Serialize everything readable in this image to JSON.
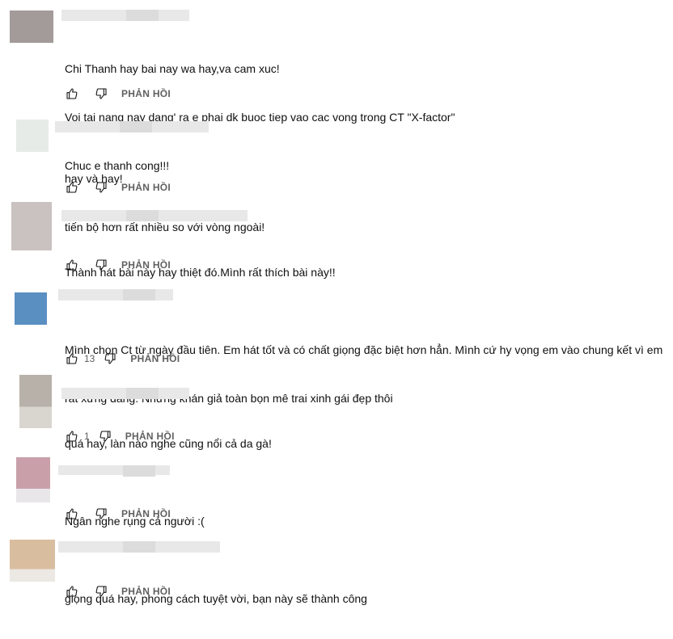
{
  "comments": [
    {
      "lines": [
        "Chi Thanh hay bai nay wa hay,va cam xuc!",
        "Voi tai nang nay dang' ra e phai dk buoc tiep vao cac vong trong CT \"X-factor\"",
        "Chuc e thanh cong!!!"
      ],
      "likes": "",
      "reply_label": "PHẢN HỒI",
      "avatar_color": "#a39a9a"
    },
    {
      "lines": [
        "hay và hay!",
        "tiến bộ hơn rất nhiều so với vòng ngoài!"
      ],
      "likes": "",
      "reply_label": "PHẢN HỒI",
      "avatar_color": "#e6ebe7"
    },
    {
      "lines": [
        "Thành hát bài này hay thiệt đó.Mình rất thích bài này!!"
      ],
      "likes": "",
      "reply_label": "PHẢN HỒI",
      "avatar_color": "#c9c2c0"
    },
    {
      "lines": [
        "Mình chọn Ct từ ngày đầu tiên. Em hát tốt và có chất giọng đặc biệt hơn hẳn. Mình cứ hy vọng em vào chung kết vì em",
        "rất xứng đáng. Nhưng khán giả toàn bọn mê trai xinh gái đẹp thôi"
      ],
      "likes": "13",
      "reply_label": "PHẢN HỒI",
      "avatar_color": "#5a8fc2"
    },
    {
      "lines": [
        "quá hay, làn nào nghe cũng nổi cả da gà!"
      ],
      "likes": "1",
      "reply_label": "PHẢN HỒI",
      "avatar_color": "#b8b1aa"
    },
    {
      "lines": [
        "Ngân nghe rụng cả người :("
      ],
      "likes": "",
      "reply_label": "PHẢN HỒI",
      "avatar_color": "#c9a0aa"
    },
    {
      "lines": [
        "giọng quá hay, phong cách tuyệt vời, bạn này sẽ thành công"
      ],
      "likes": "",
      "reply_label": "PHẢN HỒI",
      "avatar_color": "#d9bd9f"
    }
  ]
}
